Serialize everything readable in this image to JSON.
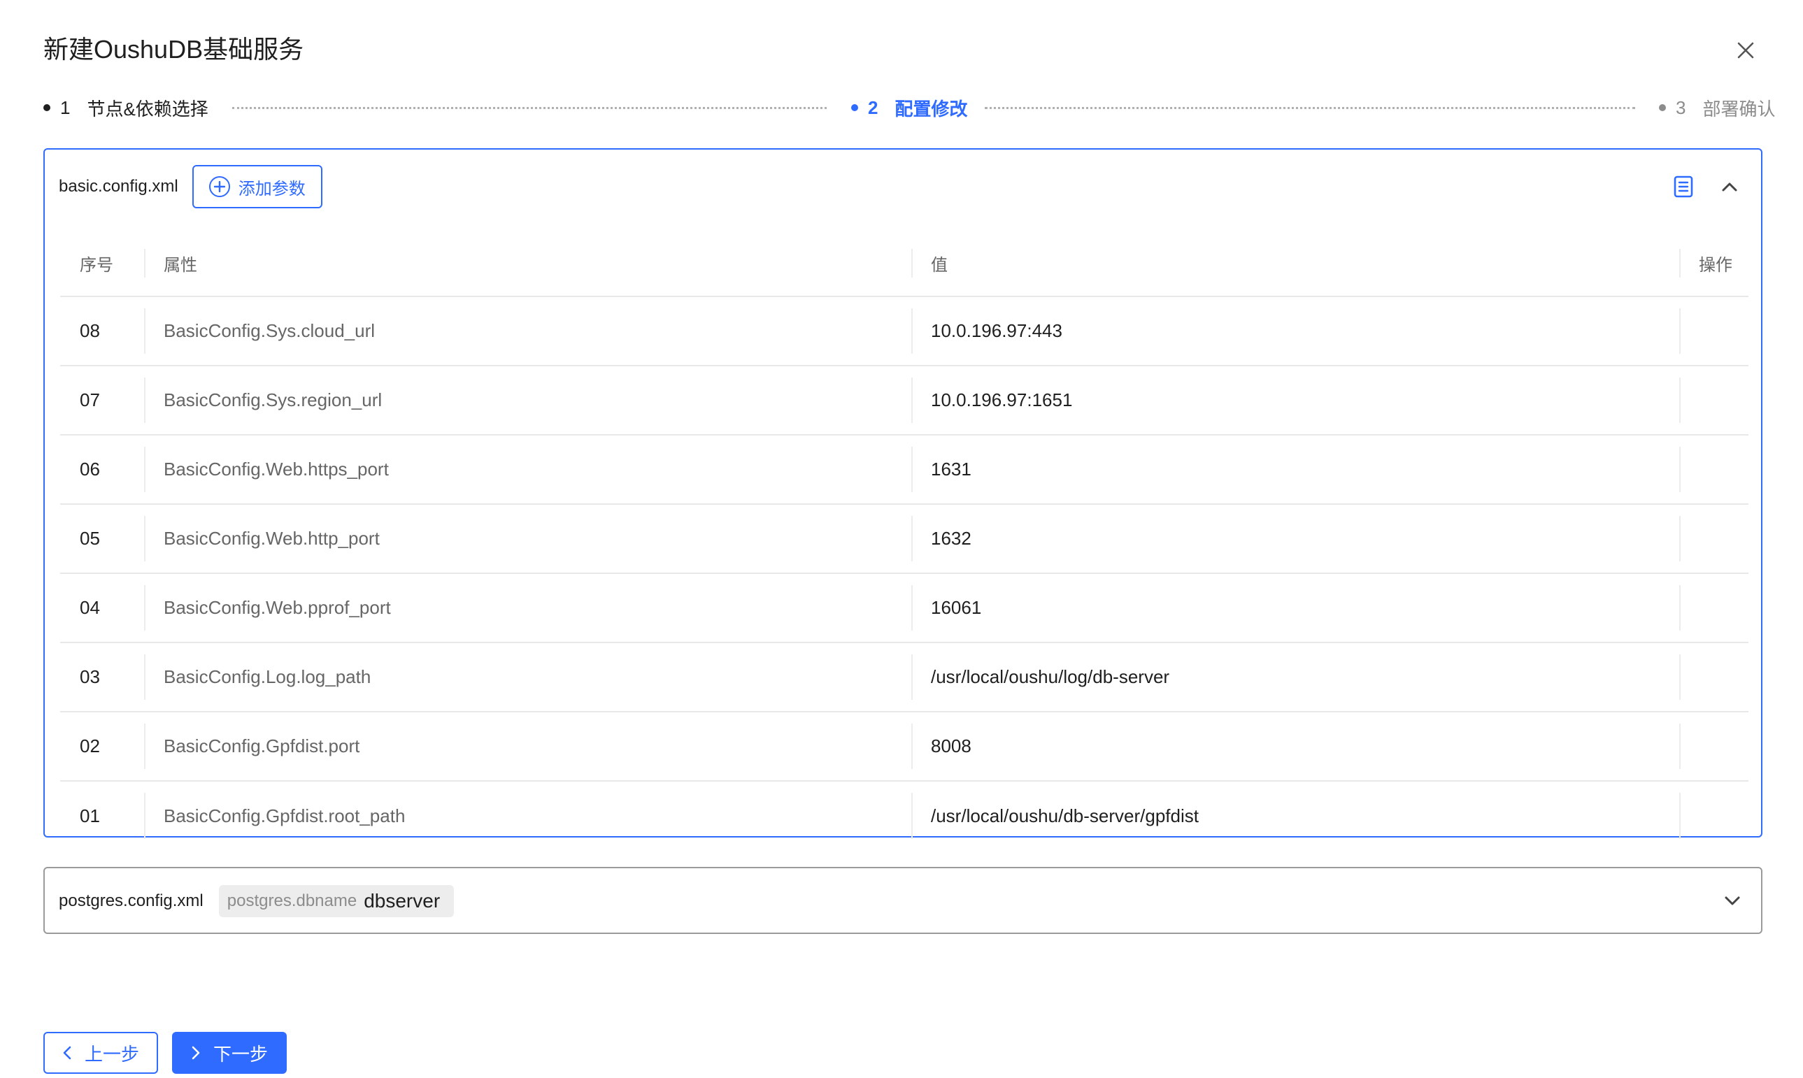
{
  "dialog": {
    "title": "新建OushuDB基础服务",
    "close_icon": "close-icon"
  },
  "steps": [
    {
      "num": "1",
      "label": "节点&依赖选择",
      "state": "done"
    },
    {
      "num": "2",
      "label": "配置修改",
      "state": "active"
    },
    {
      "num": "3",
      "label": "部署确认",
      "state": "pending"
    }
  ],
  "colors": {
    "accent": "#2f6bff",
    "text": "#1f1f1f",
    "muted": "#8c8c8c"
  },
  "basic_panel": {
    "file_name": "basic.config.xml",
    "add_param_label": "添加参数",
    "add_icon": "plus-circle-icon",
    "doc_icon": "document-icon",
    "collapse_icon": "chevron-up-icon",
    "columns": {
      "id": "序号",
      "prop": "属性",
      "value": "值",
      "op": "操作"
    },
    "rows": [
      {
        "id": "08",
        "prop": "BasicConfig.Sys.cloud_url",
        "value": "10.0.196.97:443"
      },
      {
        "id": "07",
        "prop": "BasicConfig.Sys.region_url",
        "value": "10.0.196.97:1651"
      },
      {
        "id": "06",
        "prop": "BasicConfig.Web.https_port",
        "value": "1631"
      },
      {
        "id": "05",
        "prop": "BasicConfig.Web.http_port",
        "value": "1632"
      },
      {
        "id": "04",
        "prop": "BasicConfig.Web.pprof_port",
        "value": "16061"
      },
      {
        "id": "03",
        "prop": "BasicConfig.Log.log_path",
        "value": "/usr/local/oushu/log/db-server"
      },
      {
        "id": "02",
        "prop": "BasicConfig.Gpfdist.port",
        "value": "8008"
      },
      {
        "id": "01",
        "prop": "BasicConfig.Gpfdist.root_path",
        "value": "/usr/local/oushu/db-server/gpfdist"
      }
    ]
  },
  "postgres_panel": {
    "file_name": "postgres.config.xml",
    "tag_key": "postgres.dbname",
    "tag_value": "dbserver",
    "expand_icon": "chevron-down-icon"
  },
  "footer": {
    "prev_label": "上一步",
    "next_label": "下一步",
    "prev_icon": "chevron-left-icon",
    "next_icon": "chevron-right-icon"
  }
}
